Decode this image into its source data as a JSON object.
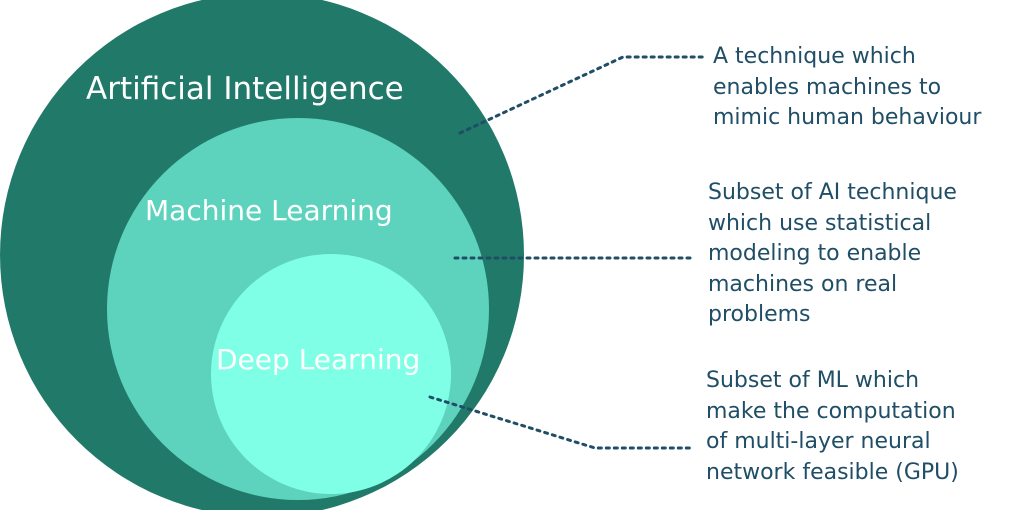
{
  "colors": {
    "ai_fill": "#217a69",
    "ml_fill": "#5dd3bd",
    "dl_fill": "#7fffe6",
    "text": "#1f4e66",
    "connector": "#1f4e66"
  },
  "circles": {
    "ai": {
      "label": "Artificial Intelligence"
    },
    "ml": {
      "label": "Machine Learning"
    },
    "dl": {
      "label": "Deep Learning"
    }
  },
  "descriptions": {
    "ai": {
      "lines": [
        "A technique which",
        "enables machines to",
        "mimic human behaviour"
      ]
    },
    "ml": {
      "lines": [
        "Subset of AI technique",
        "which use statistical",
        "modeling to enable",
        "machines on real",
        "problems"
      ]
    },
    "dl": {
      "lines": [
        "Subset of ML which",
        "make the computation",
        "of multi-layer neural",
        "network feasible (GPU)"
      ]
    }
  }
}
